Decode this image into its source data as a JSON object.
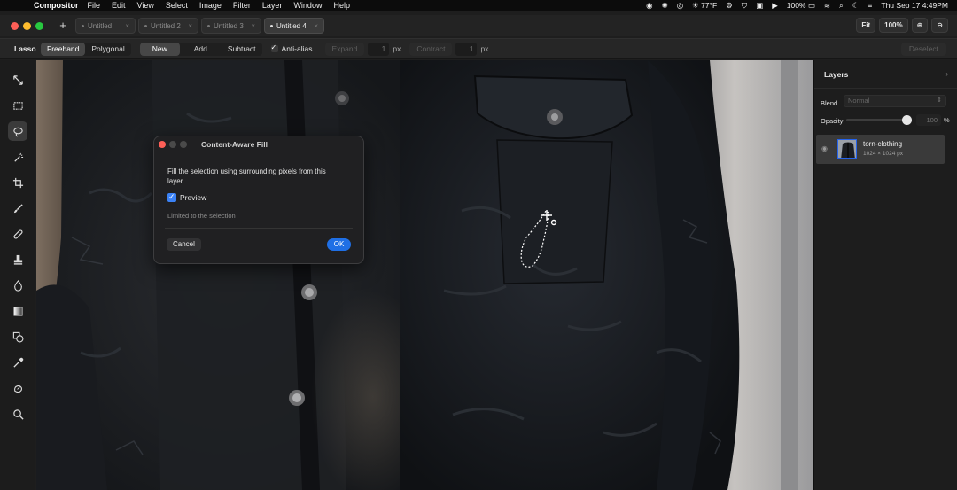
{
  "menubar": {
    "app_name": "Compositor",
    "items": [
      "File",
      "Edit",
      "View",
      "Select",
      "Image",
      "Filter",
      "Layer",
      "Window",
      "Help"
    ],
    "status": {
      "weather": "77°F",
      "battery": "100%",
      "datetime": "Thu Sep 17  4:49PM"
    }
  },
  "tabs": [
    {
      "label": "Untitled",
      "active": false
    },
    {
      "label": "Untitled 2",
      "active": false
    },
    {
      "label": "Untitled 3",
      "active": false
    },
    {
      "label": "Untitled 4",
      "active": true
    }
  ],
  "zoom": {
    "fit_label": "Fit",
    "level": "100%"
  },
  "options": {
    "tool_name": "Lasso",
    "modes": [
      "Freehand",
      "Polygonal"
    ],
    "ops": [
      "New",
      "Add",
      "Subtract"
    ],
    "antialias_label": "Anti-alias",
    "expand_label": "Expand",
    "expand_value": "1",
    "contract_label": "Contract",
    "contract_value": "1",
    "unit": "px",
    "deselect_label": "Deselect"
  },
  "tools": [
    {
      "name": "move-tool-icon"
    },
    {
      "name": "marquee-tool-icon"
    },
    {
      "name": "lasso-tool-icon",
      "active": true
    },
    {
      "name": "magic-wand-icon"
    },
    {
      "name": "crop-icon"
    },
    {
      "name": "brush-icon"
    },
    {
      "name": "healing-icon"
    },
    {
      "name": "stamp-icon"
    },
    {
      "name": "blur-drop-icon"
    },
    {
      "name": "gradient-icon"
    },
    {
      "name": "shapes-icon"
    },
    {
      "name": "eyedropper-icon"
    },
    {
      "name": "smudge-icon"
    },
    {
      "name": "zoom-icon"
    }
  ],
  "dialog": {
    "title": "Content-Aware Fill",
    "description": "Fill the selection using surrounding pixels from this layer.",
    "preview_label": "Preview",
    "note": "Limited to the selection",
    "cancel_label": "Cancel",
    "ok_label": "OK"
  },
  "layers_panel": {
    "title": "Layers",
    "blend_label": "Blend",
    "blend_value": "Normal",
    "opacity_label": "Opacity",
    "opacity_value": "100",
    "opacity_percent": 1.0,
    "percent_sign": "%",
    "layers": [
      {
        "name": "torn-clothing",
        "size": "1024 × 1024 px",
        "visible": true
      }
    ]
  },
  "colors": {
    "accent": "#1f6fe5",
    "fg_swatch": "#111111",
    "bg_swatch": "#ffffff"
  }
}
